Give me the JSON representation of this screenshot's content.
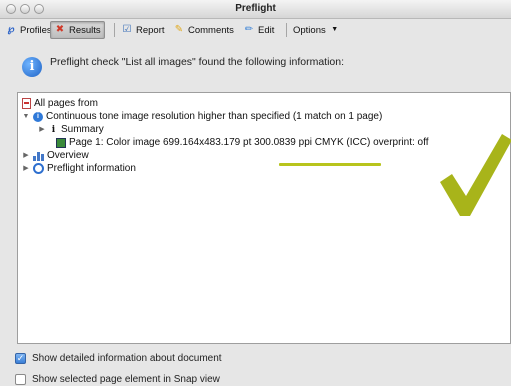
{
  "window": {
    "title": "Preflight"
  },
  "toolbar": {
    "profiles": "Profiles",
    "results": "Results",
    "report": "Report",
    "comments": "Comments",
    "edit": "Edit",
    "options": "Options"
  },
  "info": {
    "message": "Preflight check \"List all images\" found the following information:"
  },
  "tree": {
    "all_pages": "All pages from",
    "continuous_tone": "Continuous tone image resolution higher than specified (1 match on 1 page)",
    "summary": "Summary",
    "page1_prefix": "Page 1: Color image 699.164x483.179 pt ",
    "page1_highlight": "300.0839 ppi CMYK (ICC)",
    "page1_suffix": " overprint: off",
    "overview": "Overview",
    "preflight_info": "Preflight information"
  },
  "options_bottom": {
    "detailed_info": "Show detailed information about document",
    "snap_view": "Show selected page element in Snap view"
  },
  "colors": {
    "highlight": "#b8c41d",
    "checkmark": "#a8b41a"
  }
}
